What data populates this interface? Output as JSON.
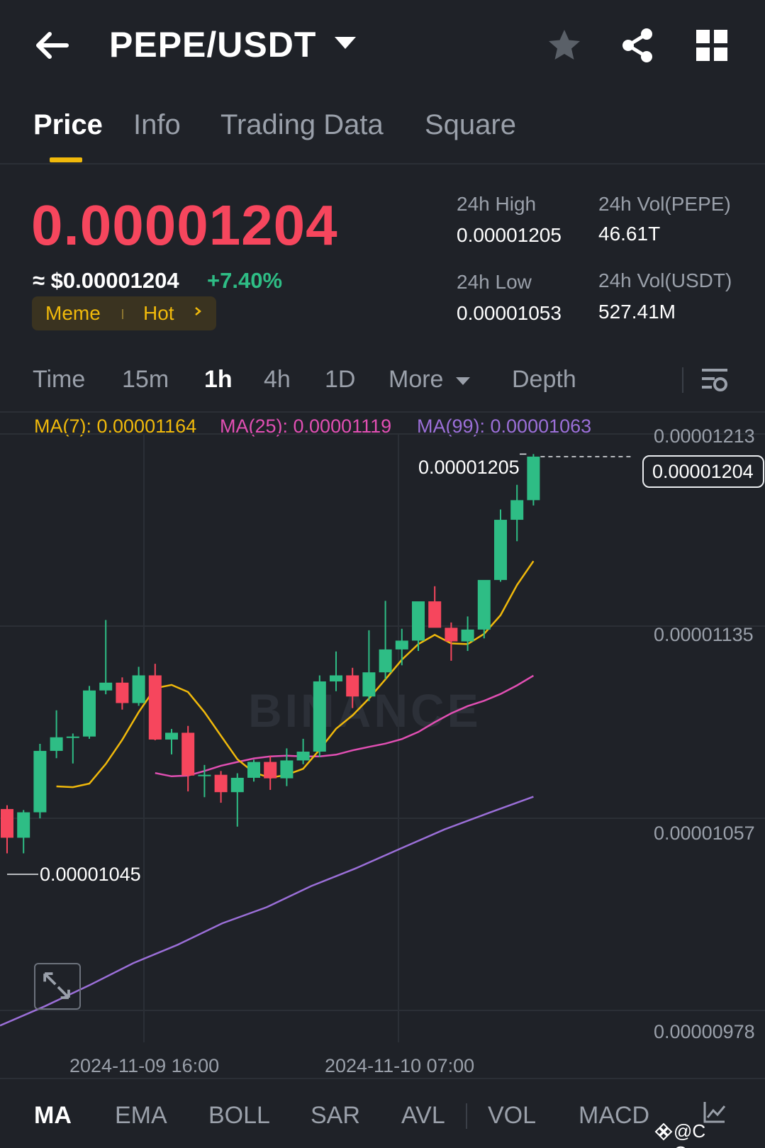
{
  "header": {
    "pair": "PEPE/USDT"
  },
  "tabs": [
    "Price",
    "Info",
    "Trading Data",
    "Square"
  ],
  "price": {
    "last": "0.00001204",
    "usd": "≈ $0.00001204",
    "change": "+7.40%",
    "tags": [
      "Meme",
      "Hot"
    ]
  },
  "stats": {
    "high_label": "24h High",
    "high_value": "0.00001205",
    "low_label": "24h Low",
    "low_value": "0.00001053",
    "vol_base_label": "24h Vol(PEPE)",
    "vol_base_value": "46.61T",
    "vol_quote_label": "24h Vol(USDT)",
    "vol_quote_value": "527.41M"
  },
  "intervals": {
    "items": [
      "Time",
      "15m",
      "1h",
      "4h",
      "1D",
      "More",
      "Depth"
    ],
    "active": "1h"
  },
  "ma_legend": {
    "ma7": "MA(7): 0.00001164",
    "ma25": "MA(25): 0.00001119",
    "ma99": "MA(99): 0.00001063"
  },
  "colors": {
    "up": "#2ebd85",
    "down": "#f6465d",
    "ma7": "#f0b90b",
    "ma25": "#e14fb3",
    "ma99": "#9b6fd8",
    "accent": "#f0b90b"
  },
  "chart_data": {
    "type": "candlestick",
    "y_ticks": [
      "0.00001213",
      "0.00001135",
      "0.00001057",
      "0.00000978"
    ],
    "x_ticks": [
      "2024-11-09 16:00",
      "2024-11-10 07:00"
    ],
    "current_price_label": "0.00001204",
    "high_marker": "0.00001205",
    "low_marker": "0.00001045",
    "watermark": "BINANCE",
    "candles": [
      {
        "o": 1064.0,
        "h": 1065.5,
        "l": 1046.4,
        "c": 1052.6
      },
      {
        "o": 1052.6,
        "h": 1063.6,
        "l": 1046.4,
        "c": 1062.7
      },
      {
        "o": 1062.7,
        "h": 1089.9,
        "l": 1060.3,
        "c": 1087.1
      },
      {
        "o": 1087.1,
        "h": 1103.2,
        "l": 1084.2,
        "c": 1092.5
      },
      {
        "o": 1092.5,
        "h": 1094.0,
        "l": 1082.1,
        "c": 1092.8
      },
      {
        "o": 1092.8,
        "h": 1112.9,
        "l": 1091.9,
        "c": 1111.1
      },
      {
        "o": 1111.1,
        "h": 1139.1,
        "l": 1109.6,
        "c": 1114.2
      },
      {
        "o": 1114.2,
        "h": 1116.3,
        "l": 1103.5,
        "c": 1106.1
      },
      {
        "o": 1106.1,
        "h": 1120.5,
        "l": 1105.0,
        "c": 1117.1
      },
      {
        "o": 1117.1,
        "h": 1121.7,
        "l": 1091.3,
        "c": 1091.6
      },
      {
        "o": 1091.6,
        "h": 1095.8,
        "l": 1085.7,
        "c": 1094.3
      },
      {
        "o": 1094.3,
        "h": 1097.0,
        "l": 1071.0,
        "c": 1077.3
      },
      {
        "o": 1077.3,
        "h": 1081.5,
        "l": 1068.7,
        "c": 1077.6
      },
      {
        "o": 1077.6,
        "h": 1079.1,
        "l": 1066.5,
        "c": 1070.7
      },
      {
        "o": 1070.7,
        "h": 1078.2,
        "l": 1057.0,
        "c": 1076.4
      },
      {
        "o": 1076.4,
        "h": 1083.6,
        "l": 1074.9,
        "c": 1082.7
      },
      {
        "o": 1082.7,
        "h": 1085.1,
        "l": 1071.6,
        "c": 1076.2
      },
      {
        "o": 1076.2,
        "h": 1088.1,
        "l": 1073.1,
        "c": 1083.3
      },
      {
        "o": 1083.3,
        "h": 1091.9,
        "l": 1081.8,
        "c": 1086.8
      },
      {
        "o": 1086.8,
        "h": 1117.1,
        "l": 1084.6,
        "c": 1114.7
      },
      {
        "o": 1114.7,
        "h": 1126.6,
        "l": 1110.8,
        "c": 1117.1
      },
      {
        "o": 1117.1,
        "h": 1120.1,
        "l": 1104.1,
        "c": 1108.7
      },
      {
        "o": 1108.7,
        "h": 1135.0,
        "l": 1106.9,
        "c": 1118.3
      },
      {
        "o": 1118.3,
        "h": 1146.7,
        "l": 1115.6,
        "c": 1127.4
      },
      {
        "o": 1127.4,
        "h": 1135.6,
        "l": 1121.1,
        "c": 1130.9
      },
      {
        "o": 1130.9,
        "h": 1143.1,
        "l": 1126.8,
        "c": 1146.5
      },
      {
        "o": 1146.5,
        "h": 1152.5,
        "l": 1136.6,
        "c": 1136.0
      },
      {
        "o": 1136.0,
        "h": 1138.1,
        "l": 1122.9,
        "c": 1130.6
      },
      {
        "o": 1130.6,
        "h": 1140.5,
        "l": 1126.8,
        "c": 1135.3
      },
      {
        "o": 1135.3,
        "h": 1141.1,
        "l": 1131.8,
        "c": 1155.0
      },
      {
        "o": 1155.0,
        "h": 1183.0,
        "l": 1154.3,
        "c": 1178.9
      },
      {
        "o": 1178.9,
        "h": 1192.8,
        "l": 1170.4,
        "c": 1186.7
      },
      {
        "o": 1186.7,
        "h": 1205.0,
        "l": 1184.6,
        "c": 1204.0
      }
    ],
    "ma7": [
      1073.0,
      1072.7,
      1074.1,
      1081.9,
      1091.5,
      1102.5,
      1112.0,
      1113.3,
      1110.5,
      1102.5,
      1093.1,
      1083.8,
      1078.5,
      1076.4,
      1077.6,
      1080.0,
      1087.6,
      1095.9,
      1101.2,
      1107.9,
      1115.5,
      1123.3,
      1129.5,
      1133.2,
      1129.8,
      1129.5,
      1133.6,
      1141.0,
      1153.0,
      1162.5
    ],
    "ma25": [
      1078.3,
      1077.0,
      1077.3,
      1079.1,
      1081.2,
      1082.7,
      1084.1,
      1084.9,
      1085.2,
      1084.9,
      1084.9,
      1085.6,
      1087.3,
      1088.7,
      1090.0,
      1091.8,
      1094.6,
      1098.5,
      1102.0,
      1104.9,
      1107.0,
      1109.7,
      1113.1,
      1117.0
    ],
    "ma99": [
      978.0,
      985.6,
      993.9,
      1002.8,
      1010.1,
      1018.6,
      1025.0,
      1033.4,
      1040.4,
      1048.2,
      1055.9,
      1062.5,
      1068.9
    ]
  },
  "indicators": {
    "items": [
      "MA",
      "EMA",
      "BOLL",
      "SAR",
      "AVL",
      "VOL",
      "MACD"
    ],
    "active": "MA"
  },
  "credit": "@C Queen"
}
